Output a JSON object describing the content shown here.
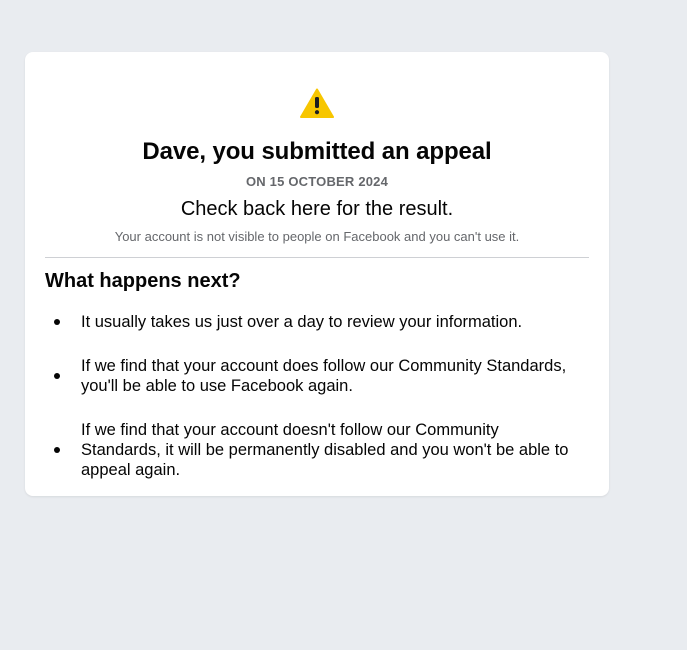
{
  "card": {
    "warning_icon": "warning-triangle-icon",
    "accent_color": "#f7c600",
    "headline": "Dave, you submitted an appeal",
    "date": "ON 15 OCTOBER 2024",
    "check_back": "Check back here for the result.",
    "notice": "Your account is not visible to people on Facebook and you can't use it."
  },
  "next": {
    "title": "What happens next?",
    "items": [
      "It usually takes us just over a day to review your information.",
      "If we find that your account does follow our Community Standards, you'll be able to use Facebook again.",
      "If we find that your account doesn't follow our Community Standards, it will be permanently disabled and you won't be able to appeal again."
    ]
  }
}
